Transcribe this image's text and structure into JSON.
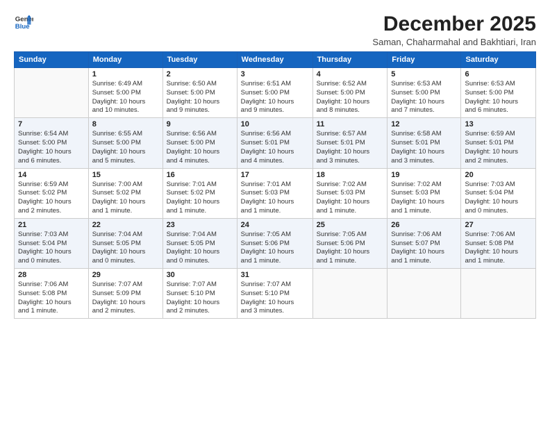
{
  "logo": {
    "text_general": "General",
    "text_blue": "Blue"
  },
  "header": {
    "month_title": "December 2025",
    "subtitle": "Saman, Chaharmahal and Bakhtiari, Iran"
  },
  "days_of_week": [
    "Sunday",
    "Monday",
    "Tuesday",
    "Wednesday",
    "Thursday",
    "Friday",
    "Saturday"
  ],
  "weeks": [
    [
      {
        "day": "",
        "info": ""
      },
      {
        "day": "1",
        "info": "Sunrise: 6:49 AM\nSunset: 5:00 PM\nDaylight: 10 hours\nand 10 minutes."
      },
      {
        "day": "2",
        "info": "Sunrise: 6:50 AM\nSunset: 5:00 PM\nDaylight: 10 hours\nand 9 minutes."
      },
      {
        "day": "3",
        "info": "Sunrise: 6:51 AM\nSunset: 5:00 PM\nDaylight: 10 hours\nand 9 minutes."
      },
      {
        "day": "4",
        "info": "Sunrise: 6:52 AM\nSunset: 5:00 PM\nDaylight: 10 hours\nand 8 minutes."
      },
      {
        "day": "5",
        "info": "Sunrise: 6:53 AM\nSunset: 5:00 PM\nDaylight: 10 hours\nand 7 minutes."
      },
      {
        "day": "6",
        "info": "Sunrise: 6:53 AM\nSunset: 5:00 PM\nDaylight: 10 hours\nand 6 minutes."
      }
    ],
    [
      {
        "day": "7",
        "info": "Sunrise: 6:54 AM\nSunset: 5:00 PM\nDaylight: 10 hours\nand 6 minutes."
      },
      {
        "day": "8",
        "info": "Sunrise: 6:55 AM\nSunset: 5:00 PM\nDaylight: 10 hours\nand 5 minutes."
      },
      {
        "day": "9",
        "info": "Sunrise: 6:56 AM\nSunset: 5:00 PM\nDaylight: 10 hours\nand 4 minutes."
      },
      {
        "day": "10",
        "info": "Sunrise: 6:56 AM\nSunset: 5:01 PM\nDaylight: 10 hours\nand 4 minutes."
      },
      {
        "day": "11",
        "info": "Sunrise: 6:57 AM\nSunset: 5:01 PM\nDaylight: 10 hours\nand 3 minutes."
      },
      {
        "day": "12",
        "info": "Sunrise: 6:58 AM\nSunset: 5:01 PM\nDaylight: 10 hours\nand 3 minutes."
      },
      {
        "day": "13",
        "info": "Sunrise: 6:59 AM\nSunset: 5:01 PM\nDaylight: 10 hours\nand 2 minutes."
      }
    ],
    [
      {
        "day": "14",
        "info": "Sunrise: 6:59 AM\nSunset: 5:02 PM\nDaylight: 10 hours\nand 2 minutes."
      },
      {
        "day": "15",
        "info": "Sunrise: 7:00 AM\nSunset: 5:02 PM\nDaylight: 10 hours\nand 1 minute."
      },
      {
        "day": "16",
        "info": "Sunrise: 7:01 AM\nSunset: 5:02 PM\nDaylight: 10 hours\nand 1 minute."
      },
      {
        "day": "17",
        "info": "Sunrise: 7:01 AM\nSunset: 5:03 PM\nDaylight: 10 hours\nand 1 minute."
      },
      {
        "day": "18",
        "info": "Sunrise: 7:02 AM\nSunset: 5:03 PM\nDaylight: 10 hours\nand 1 minute."
      },
      {
        "day": "19",
        "info": "Sunrise: 7:02 AM\nSunset: 5:03 PM\nDaylight: 10 hours\nand 1 minute."
      },
      {
        "day": "20",
        "info": "Sunrise: 7:03 AM\nSunset: 5:04 PM\nDaylight: 10 hours\nand 0 minutes."
      }
    ],
    [
      {
        "day": "21",
        "info": "Sunrise: 7:03 AM\nSunset: 5:04 PM\nDaylight: 10 hours\nand 0 minutes."
      },
      {
        "day": "22",
        "info": "Sunrise: 7:04 AM\nSunset: 5:05 PM\nDaylight: 10 hours\nand 0 minutes."
      },
      {
        "day": "23",
        "info": "Sunrise: 7:04 AM\nSunset: 5:05 PM\nDaylight: 10 hours\nand 0 minutes."
      },
      {
        "day": "24",
        "info": "Sunrise: 7:05 AM\nSunset: 5:06 PM\nDaylight: 10 hours\nand 1 minute."
      },
      {
        "day": "25",
        "info": "Sunrise: 7:05 AM\nSunset: 5:06 PM\nDaylight: 10 hours\nand 1 minute."
      },
      {
        "day": "26",
        "info": "Sunrise: 7:06 AM\nSunset: 5:07 PM\nDaylight: 10 hours\nand 1 minute."
      },
      {
        "day": "27",
        "info": "Sunrise: 7:06 AM\nSunset: 5:08 PM\nDaylight: 10 hours\nand 1 minute."
      }
    ],
    [
      {
        "day": "28",
        "info": "Sunrise: 7:06 AM\nSunset: 5:08 PM\nDaylight: 10 hours\nand 1 minute."
      },
      {
        "day": "29",
        "info": "Sunrise: 7:07 AM\nSunset: 5:09 PM\nDaylight: 10 hours\nand 2 minutes."
      },
      {
        "day": "30",
        "info": "Sunrise: 7:07 AM\nSunset: 5:10 PM\nDaylight: 10 hours\nand 2 minutes."
      },
      {
        "day": "31",
        "info": "Sunrise: 7:07 AM\nSunset: 5:10 PM\nDaylight: 10 hours\nand 3 minutes."
      },
      {
        "day": "",
        "info": ""
      },
      {
        "day": "",
        "info": ""
      },
      {
        "day": "",
        "info": ""
      }
    ]
  ]
}
